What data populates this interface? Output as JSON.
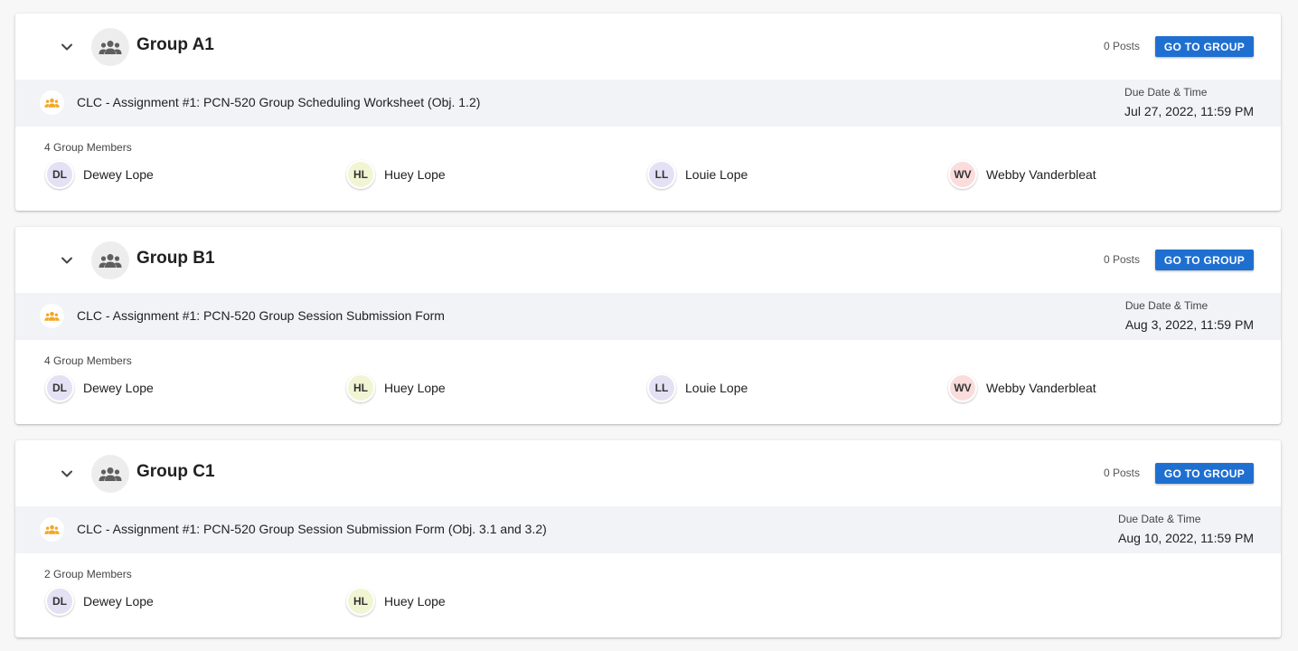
{
  "groups": [
    {
      "name": "Group A1",
      "posts": "0 Posts",
      "button": "GO TO GROUP",
      "assignment": "CLC - Assignment #1: PCN-520 Group Scheduling Worksheet (Obj. 1.2)",
      "due_label": "Due Date & Time",
      "due_value": "Jul 27, 2022, 11:59 PM",
      "member_count": "4 Group Members",
      "members": [
        {
          "initials": "DL",
          "name": "Dewey Lope",
          "color": "#e5e1f4"
        },
        {
          "initials": "HL",
          "name": "Huey Lope",
          "color": "#f2f5d3"
        },
        {
          "initials": "LL",
          "name": "Louie Lope",
          "color": "#e5e1f4"
        },
        {
          "initials": "WV",
          "name": "Webby Vanderbleat",
          "color": "#fbdcdc"
        }
      ]
    },
    {
      "name": "Group B1",
      "posts": "0 Posts",
      "button": "GO TO GROUP",
      "assignment": "CLC - Assignment #1: PCN-520 Group Session Submission Form",
      "due_label": "Due Date & Time",
      "due_value": "Aug 3, 2022, 11:59 PM",
      "member_count": "4 Group Members",
      "members": [
        {
          "initials": "DL",
          "name": "Dewey Lope",
          "color": "#e5e1f4"
        },
        {
          "initials": "HL",
          "name": "Huey Lope",
          "color": "#f2f5d3"
        },
        {
          "initials": "LL",
          "name": "Louie Lope",
          "color": "#e5e1f4"
        },
        {
          "initials": "WV",
          "name": "Webby Vanderbleat",
          "color": "#fbdcdc"
        }
      ]
    },
    {
      "name": "Group C1",
      "posts": "0 Posts",
      "button": "GO TO GROUP",
      "assignment": "CLC - Assignment #1: PCN-520 Group Session Submission Form (Obj. 3.1 and 3.2)",
      "due_label": "Due Date & Time",
      "due_value": "Aug 10, 2022, 11:59 PM",
      "member_count": "2 Group Members",
      "members": [
        {
          "initials": "DL",
          "name": "Dewey Lope",
          "color": "#e5e1f4"
        },
        {
          "initials": "HL",
          "name": "Huey Lope",
          "color": "#f2f5d3"
        }
      ]
    }
  ],
  "colors": {
    "accent": "#1f6fd1",
    "assignment_icon": "#f5a623",
    "group_icon": "#5f5f5f"
  },
  "icons": {
    "collapse": "chevron-down-icon",
    "group": "group-icon",
    "assignment": "assignment-group-icon"
  }
}
